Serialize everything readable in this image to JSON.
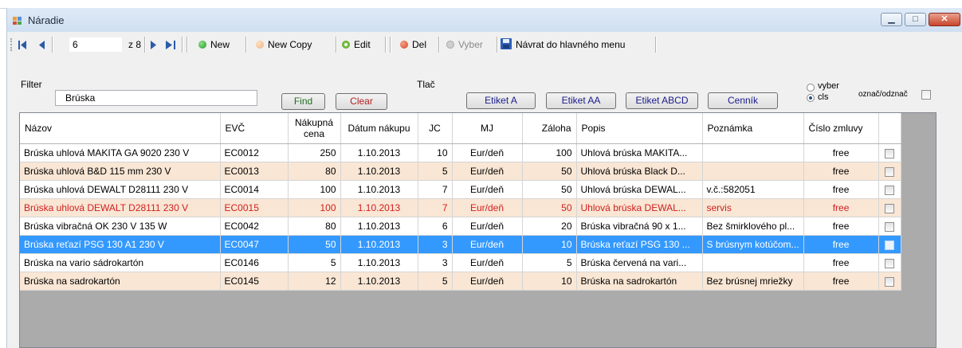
{
  "window": {
    "title": "Náradie"
  },
  "toolbar": {
    "record_value": "6",
    "of_label": "z 8",
    "new_label": "New",
    "new_copy_label": "New Copy",
    "edit_label": "Edit",
    "del_label": "Del",
    "vyber_label": "Vyber",
    "back_label": "Návrat do hlavného menu"
  },
  "filter": {
    "label": "Filter",
    "value": "Brúska",
    "find_label": "Find",
    "clear_label": "Clear"
  },
  "print": {
    "label": "Tlač",
    "etiket_a": "Etiket A",
    "etiket_aa": "Etiket AA",
    "etiket_abcd": "Etiket ABCD",
    "cennik": "Cenník",
    "radio_vyber": "vyber",
    "radio_cls": "cls",
    "selected_radio": "cls",
    "mark_label": "označ/odznač"
  },
  "grid": {
    "columns": [
      "Názov",
      "EVČ",
      "Nákupná cena",
      "Dátum nákupu",
      "JC",
      "MJ",
      "Záloha",
      "Popis",
      "Poznámka",
      "Číslo zmluvy"
    ],
    "rows": [
      {
        "nazov": "Brúska uhlová MAKITA GA 9020 230 V",
        "evc": "EC0012",
        "cena": "250",
        "datum": "1.10.2013",
        "jc": "10",
        "mj": "Eur/deň",
        "zaloha": "100",
        "popis": "Uhlová brúska MAKITA...",
        "poznamka": "",
        "zmluva": "free",
        "style": "w"
      },
      {
        "nazov": "Brúska uhlová B&D 115 mm 230 V",
        "evc": "EC0013",
        "cena": "80",
        "datum": "1.10.2013",
        "jc": "5",
        "mj": "Eur/deň",
        "zaloha": "50",
        "popis": "Uhlová brúska Black D...",
        "poznamka": "",
        "zmluva": "free",
        "style": "p"
      },
      {
        "nazov": "Brúska uhlová DEWALT D28111 230 V",
        "evc": "EC0014",
        "cena": "100",
        "datum": "1.10.2013",
        "jc": "7",
        "mj": "Eur/deň",
        "zaloha": "50",
        "popis": "Uhlová brúska DEWAL...",
        "poznamka": "v.č.:582051",
        "zmluva": "free",
        "style": "w"
      },
      {
        "nazov": "Brúska uhlová DEWALT D28111 230 V",
        "evc": "EC0015",
        "cena": "100",
        "datum": "1.10.2013",
        "jc": "7",
        "mj": "Eur/deň",
        "zaloha": "50",
        "popis": "Uhlová brúska DEWAL...",
        "poznamka": "servis",
        "zmluva": "free",
        "style": "p red"
      },
      {
        "nazov": "Brúska vibračná  OK 230 V 135 W",
        "evc": "EC0042",
        "cena": "80",
        "datum": "1.10.2013",
        "jc": "6",
        "mj": "Eur/deň",
        "zaloha": "20",
        "popis": "Brúska vibračná 90 x 1...",
        "poznamka": "Bez šmirklového pl...",
        "zmluva": "free",
        "style": "w"
      },
      {
        "nazov": "Brúska reťazí PSG 130 A1 230 V",
        "evc": "EC0047",
        "cena": "50",
        "datum": "1.10.2013",
        "jc": "3",
        "mj": "Eur/deň",
        "zaloha": "10",
        "popis": "Brúska reťazí PSG 130 ...",
        "poznamka": "S brúsnym kotúčom...",
        "zmluva": "free",
        "style": "sel"
      },
      {
        "nazov": "Brúska na vario sádrokartón",
        "evc": "EC0146",
        "cena": "5",
        "datum": "1.10.2013",
        "jc": "3",
        "mj": "Eur/deň",
        "zaloha": "5",
        "popis": "Brúska červená na vari...",
        "poznamka": "",
        "zmluva": "free",
        "style": "w"
      },
      {
        "nazov": "Brúska na sadrokartón",
        "evc": "EC0145",
        "cena": "12",
        "datum": "1.10.2013",
        "jc": "5",
        "mj": "Eur/deň",
        "zaloha": "10",
        "popis": "Brúska na sadrokartón",
        "poznamka": "Bez brúsnej mriežky",
        "zmluva": "free",
        "style": "p"
      }
    ]
  },
  "colors": {
    "selected_row": "#3399ff",
    "alt_row": "#f9e6d4",
    "deleted_row_text": "#d02020"
  }
}
